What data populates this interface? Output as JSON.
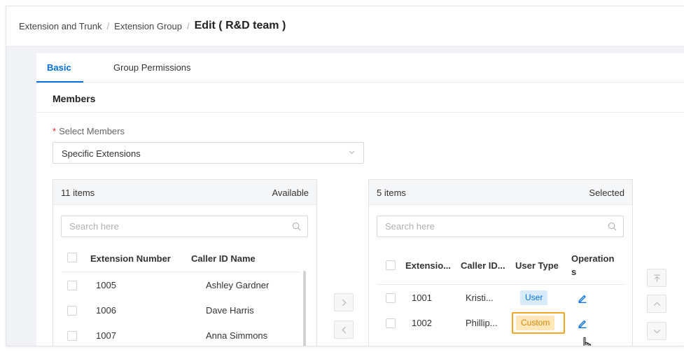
{
  "breadcrumb": {
    "items": [
      "Extension and Trunk",
      "Extension Group"
    ],
    "separator": "/",
    "current": "Edit ( R&D team )"
  },
  "tabs": [
    {
      "label": "Basic",
      "active": true
    },
    {
      "label": "Group Permissions",
      "active": false
    }
  ],
  "section": {
    "title": "Members"
  },
  "select_members": {
    "label": "Select Members",
    "required_mark": "*",
    "value": "Specific Extensions"
  },
  "available": {
    "count": "11 items",
    "title": "Available",
    "search_placeholder": "Search here",
    "columns": [
      "Extension Number",
      "Caller ID Name"
    ],
    "rows": [
      {
        "ext": "1005",
        "name": "Ashley Gardner"
      },
      {
        "ext": "1006",
        "name": "Dave Harris"
      },
      {
        "ext": "1007",
        "name": "Anna Simmons"
      }
    ]
  },
  "selected": {
    "count": "5 items",
    "title": "Selected",
    "search_placeholder": "Search here",
    "columns": [
      "Extensio...",
      "Caller ID...",
      "User Type",
      "Operation",
      "s"
    ],
    "rows": [
      {
        "ext": "1001",
        "name": "Kristi...",
        "type": "User"
      },
      {
        "ext": "1002",
        "name": "Phillip...",
        "type": "Custom"
      }
    ]
  },
  "transfer_buttons": {
    "right": "›",
    "left": "‹"
  },
  "colors": {
    "primary": "#006ee1",
    "user_tag_bg": "#d9ebfb",
    "custom_tag_bg": "#ffe7ba",
    "custom_tag_text": "#d48806",
    "highlight": "#f5a623",
    "required": "#f5222d"
  }
}
